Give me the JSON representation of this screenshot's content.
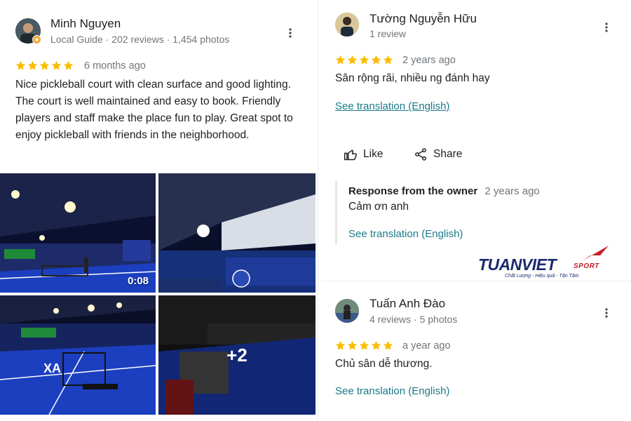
{
  "review_1": {
    "name": "Minh Nguyen",
    "meta": "Local Guide · 202 reviews · 1,454 photos",
    "rating": 5,
    "time": "6 months ago",
    "text": "Nice pickleball court with clean surface and good lighting. The court is well maintained and easy to book. Friendly players and staff make the place fun to play. Great spot to enjoy pickleball with friends in the neighborhood.",
    "photos": {
      "video_duration": "0:08",
      "more_count": "+2"
    }
  },
  "review_2": {
    "name": "Tường Nguyễn Hữu",
    "meta": "1 review",
    "rating": 5,
    "time": "2 years ago",
    "text": "Sân rộng rãi, nhiều ng đánh hay",
    "translate_link": "See translation (English)",
    "actions": {
      "like": "Like",
      "share": "Share"
    },
    "owner_response": {
      "title": "Response from the owner",
      "time": "2 years ago",
      "text": "Cảm ơn anh",
      "translate_link": "See translation (English)"
    }
  },
  "review_3": {
    "name": "Tuấn Anh Đào",
    "meta": "4 reviews · 5 photos",
    "rating": 5,
    "time": "a year ago",
    "text": "Chủ sân dễ thương.",
    "translate_link": "See translation (English)"
  },
  "logo": {
    "main": "TUANVIET",
    "sport": "SPORT",
    "tagline": "Chất Lượng - Hiệu quả - Tận Tâm"
  },
  "colors": {
    "star": "#fbbc04",
    "link": "#1a7a8a",
    "muted": "#70757a",
    "court_blue": "#1c3fbf"
  }
}
